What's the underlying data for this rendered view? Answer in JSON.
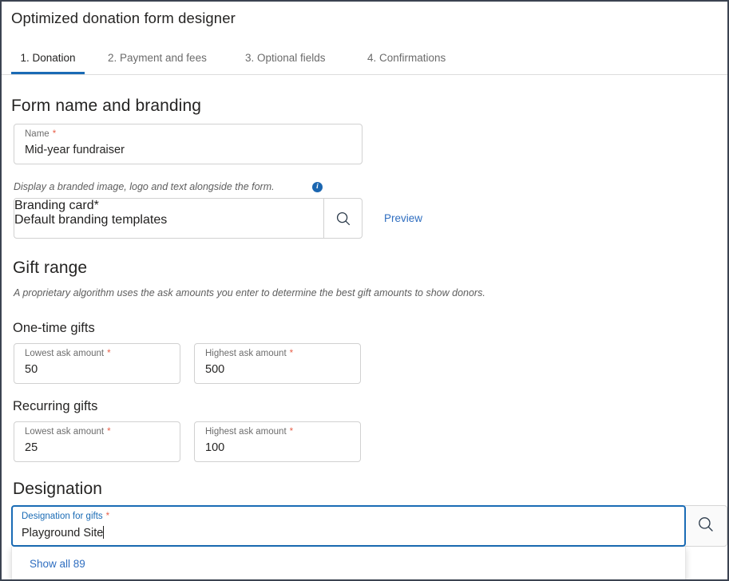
{
  "header": {
    "title": "Optimized donation form designer"
  },
  "tabs": [
    {
      "label": "1. Donation",
      "active": true
    },
    {
      "label": "2. Payment and fees",
      "active": false
    },
    {
      "label": "3. Optional fields",
      "active": false
    },
    {
      "label": "4. Confirmations",
      "active": false
    }
  ],
  "sections": {
    "branding": {
      "heading": "Form name and branding",
      "name_field": {
        "label": "Name",
        "required_mark": "*",
        "value": "Mid-year fundraiser"
      },
      "helper_text": "Display a branded image, logo and text alongside the form.",
      "info_glyph": "i",
      "branding_card": {
        "label": "Branding card",
        "required_mark": "*",
        "value": "Default branding templates"
      },
      "search_icon_name": "search-icon",
      "preview_link": "Preview"
    },
    "gift_range": {
      "heading": "Gift range",
      "helper_text": "A proprietary algorithm uses the ask amounts you enter to determine the best gift amounts to show donors.",
      "one_time": {
        "heading": "One-time gifts",
        "lowest": {
          "label": "Lowest ask amount",
          "required_mark": "*",
          "value": "50"
        },
        "highest": {
          "label": "Highest ask amount",
          "required_mark": "*",
          "value": "500"
        }
      },
      "recurring": {
        "heading": "Recurring gifts",
        "lowest": {
          "label": "Lowest ask amount",
          "required_mark": "*",
          "value": "25"
        },
        "highest": {
          "label": "Highest ask amount",
          "required_mark": "*",
          "value": "100"
        }
      }
    },
    "designation": {
      "heading": "Designation",
      "field": {
        "label": "Designation for gifts",
        "required_mark": "*",
        "value": "Playground Site"
      },
      "search_icon_name": "search-icon",
      "dropdown": {
        "show_all": "Show all 89"
      }
    }
  },
  "colors": {
    "accent_blue": "#1a6bb5",
    "link_blue": "#2f6ec0",
    "required_red": "#e8614b",
    "text_primary": "#252423",
    "text_muted": "#6b6b6b",
    "border": "#d1d1d1",
    "window_border": "#3b4351"
  }
}
